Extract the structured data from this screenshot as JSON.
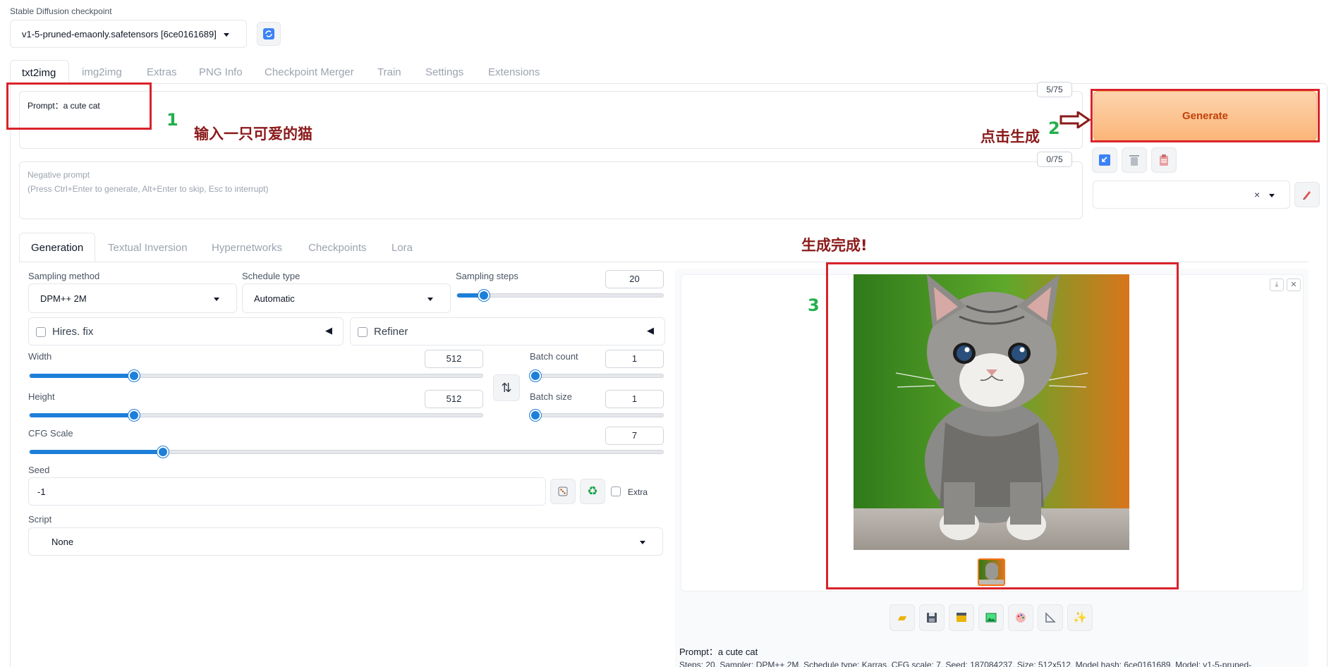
{
  "checkpoint": {
    "label": "Stable Diffusion checkpoint",
    "value": "v1-5-pruned-emaonly.safetensors [6ce0161689]"
  },
  "main_tabs": [
    "txt2img",
    "img2img",
    "Extras",
    "PNG Info",
    "Checkpoint Merger",
    "Train",
    "Settings",
    "Extensions"
  ],
  "prompt": {
    "value": "Prompt：a cute cat",
    "counter": "5/75"
  },
  "negative": {
    "placeholder_line1": "Negative prompt",
    "placeholder_line2": "(Press Ctrl+Enter to generate, Alt+Enter to skip, Esc to interrupt)",
    "counter": "0/75"
  },
  "generate_label": "Generate",
  "styles_clear": "×",
  "sub_tabs": [
    "Generation",
    "Textual Inversion",
    "Hypernetworks",
    "Checkpoints",
    "Lora"
  ],
  "sampling": {
    "method_label": "Sampling method",
    "method_value": "DPM++ 2M",
    "schedule_label": "Schedule type",
    "schedule_value": "Automatic",
    "steps_label": "Sampling steps",
    "steps_value": "20",
    "steps_fraction": 0.13
  },
  "hires_label": "Hires. fix",
  "refiner_label": "Refiner",
  "width": {
    "label": "Width",
    "value": "512",
    "fraction": 0.23
  },
  "height": {
    "label": "Height",
    "value": "512",
    "fraction": 0.23
  },
  "batch_count": {
    "label": "Batch count",
    "value": "1",
    "fraction": 0.0
  },
  "batch_size": {
    "label": "Batch size",
    "value": "1",
    "fraction": 0.0
  },
  "cfg": {
    "label": "CFG Scale",
    "value": "7",
    "fraction": 0.21
  },
  "seed": {
    "label": "Seed",
    "value": "-1",
    "extra_label": "Extra"
  },
  "script": {
    "label": "Script",
    "value": "None"
  },
  "output": {
    "prompt_text": "Prompt：a cute cat",
    "info_text": "Steps: 20, Sampler: DPM++ 2M, Schedule type: Karras, CFG scale: 7, Seed: 187084237, Size: 512x512, Model hash: 6ce0161689, Model: v1-5-pruned-"
  },
  "annotations": {
    "n1": "1",
    "t1": "输入一只可爱的猫",
    "n2": "2",
    "t2": "点击生成",
    "n3": "3",
    "t3": "生成完成!"
  },
  "colors": {
    "accent": "#1e7fd9",
    "annotation_red": "#d9232a",
    "annotation_green": "#22b14c",
    "annotation_text": "#8b1a1a",
    "generate_bg": "#fbc08d"
  }
}
